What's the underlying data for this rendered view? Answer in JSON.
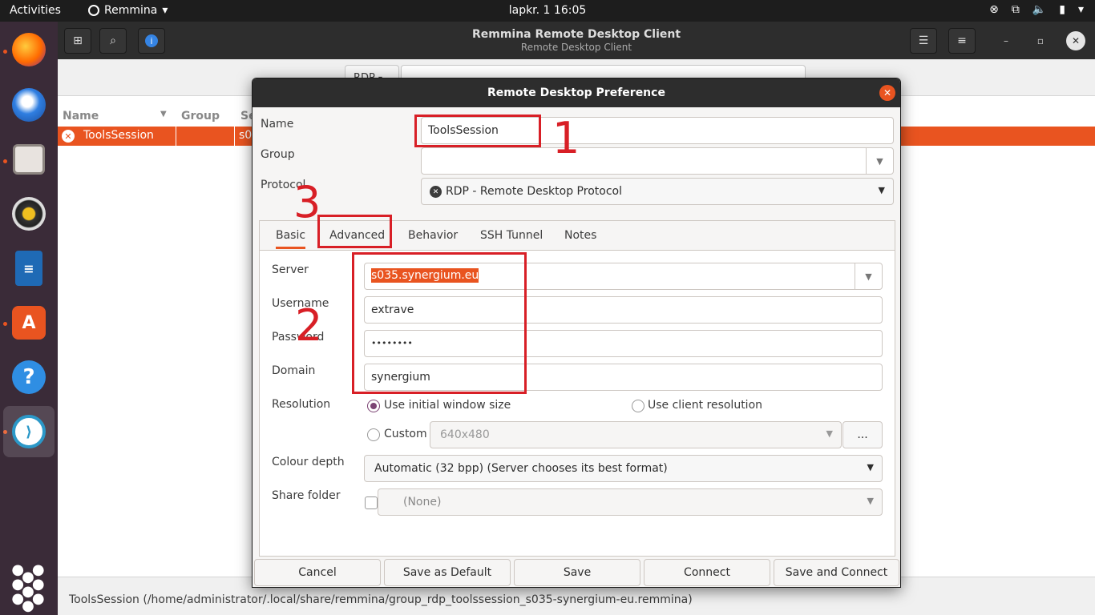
{
  "topbar": {
    "activities": "Activities",
    "app_name": "Remmina",
    "clock": "lapkr. 1  16:05"
  },
  "dock": {
    "apps": [
      "firefox-icon",
      "thunderbird-icon",
      "files-icon",
      "rhythmbox-icon",
      "libreoffice-writer-icon",
      "app-center-icon",
      "help-icon",
      "remmina-icon"
    ],
    "show_apps": "show-applications-icon"
  },
  "window": {
    "title": "Remmina Remote Desktop Client",
    "subtitle": "Remote Desktop Client",
    "protocol_selector": "RDP",
    "list_headers": [
      "Name",
      "Group",
      "Se"
    ],
    "row": {
      "name": "ToolsSession",
      "server": "s0"
    },
    "status": "ToolsSession (/home/administrator/.local/share/remmina/group_rdp_toolssession_s035-synergium-eu.remmina)"
  },
  "dialog": {
    "title": "Remote Desktop Preference",
    "name_label": "Name",
    "name_value": "ToolsSession",
    "group_label": "Group",
    "group_value": "",
    "protocol_label": "Protocol",
    "protocol_value": "RDP - Remote Desktop Protocol",
    "tabs": [
      "Basic",
      "Advanced",
      "Behavior",
      "SSH Tunnel",
      "Notes"
    ],
    "active_tab": "Basic",
    "server_label": "Server",
    "server_value": "s035.synergium.eu",
    "username_label": "Username",
    "username_value": "extrave",
    "password_label": "Password",
    "password_value": "••••••••",
    "domain_label": "Domain",
    "domain_value": "synergium",
    "resolution_label": "Resolution",
    "res_initial": "Use initial window size",
    "res_client": "Use client resolution",
    "res_custom": "Custom",
    "res_custom_value": "640x480",
    "res_more": "...",
    "colour_label": "Colour depth",
    "colour_value": "Automatic (32 bpp) (Server chooses its best format)",
    "share_label": "Share folder",
    "share_value": "(None)",
    "buttons": {
      "cancel": "Cancel",
      "save_default": "Save as Default",
      "save": "Save",
      "connect": "Connect",
      "save_connect": "Save and Connect"
    }
  },
  "annotations": {
    "n1": "1",
    "n2": "2",
    "n3": "3",
    "color": "#d81f26"
  },
  "colors": {
    "accent": "#e95420",
    "radio": "#7c4474"
  }
}
